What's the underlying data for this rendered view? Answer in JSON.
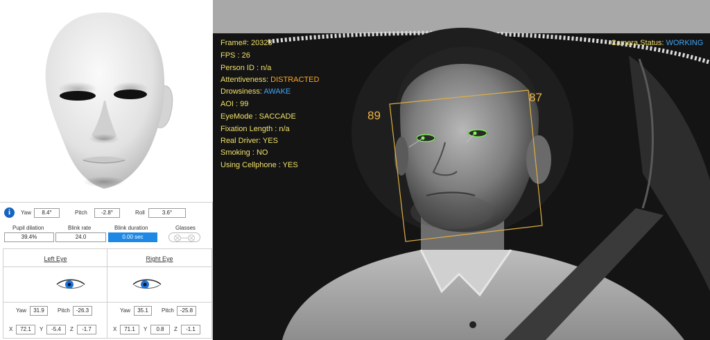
{
  "head_pose": {
    "yaw_label": "Yaw",
    "yaw_value": "8.4°",
    "pitch_label": "Pitch",
    "pitch_value": "-2.8°",
    "roll_label": "Roll",
    "roll_value": "3.6°",
    "info_glyph": "i"
  },
  "metrics": {
    "pupil_dilation_label": "Pupil dilation",
    "pupil_dilation_value": "39.4%",
    "blink_rate_label": "Blink rate",
    "blink_rate_value": "24.0",
    "blink_duration_label": "Blink duration",
    "blink_duration_value": "0.00 sec",
    "glasses_label": "Glasses"
  },
  "left_eye": {
    "title": "Left  Eye",
    "yaw_label": "Yaw",
    "yaw_value": "31.9",
    "pitch_label": "Pitch",
    "pitch_value": "-26.3",
    "x_label": "X",
    "x_value": "72.1",
    "y_label": "Y",
    "y_value": "-5.4",
    "z_label": "Z",
    "z_value": "-1.7"
  },
  "right_eye": {
    "title": "Right  Eye",
    "yaw_label": "Yaw",
    "yaw_value": "35.1",
    "pitch_label": "Pitch",
    "pitch_value": "-25.8",
    "x_label": "X",
    "x_value": "71.1",
    "y_label": "Y",
    "y_value": "0.8",
    "z_label": "Z",
    "z_value": "-1.1"
  },
  "overlay": {
    "frame_label": "Frame#:",
    "frame_value": "20323",
    "fps_label": "FPS :",
    "fps_value": "26",
    "person_id": "Person ID : n/a",
    "attentiveness_label": "Attentiveness:",
    "attentiveness_value": "DISTRACTED",
    "drowsiness_label": "Drowsiness:",
    "drowsiness_value": "AWAKE",
    "aoi": "AOI : 99",
    "eye_mode": "EyeMode : SACCADE",
    "fixation_length": "Fixation Length : n/a",
    "real_driver": "Real Driver: YES",
    "smoking": "Smoking : NO",
    "using_cellphone": "Using Cellphone : YES",
    "camera_status_label": "Camera Status:",
    "camera_status_value": "WORKING",
    "score_left": "89",
    "score_right": "87"
  },
  "colors": {
    "overlay_text": "#f0e06a",
    "status_blue": "#42a5f5",
    "status_orange": "#ffa726",
    "face_box": "#e0b040",
    "blink_duration_bg": "#1e88e5"
  },
  "icons": [
    "info-icon",
    "glasses-icon",
    "left-eye-icon",
    "right-eye-icon"
  ]
}
